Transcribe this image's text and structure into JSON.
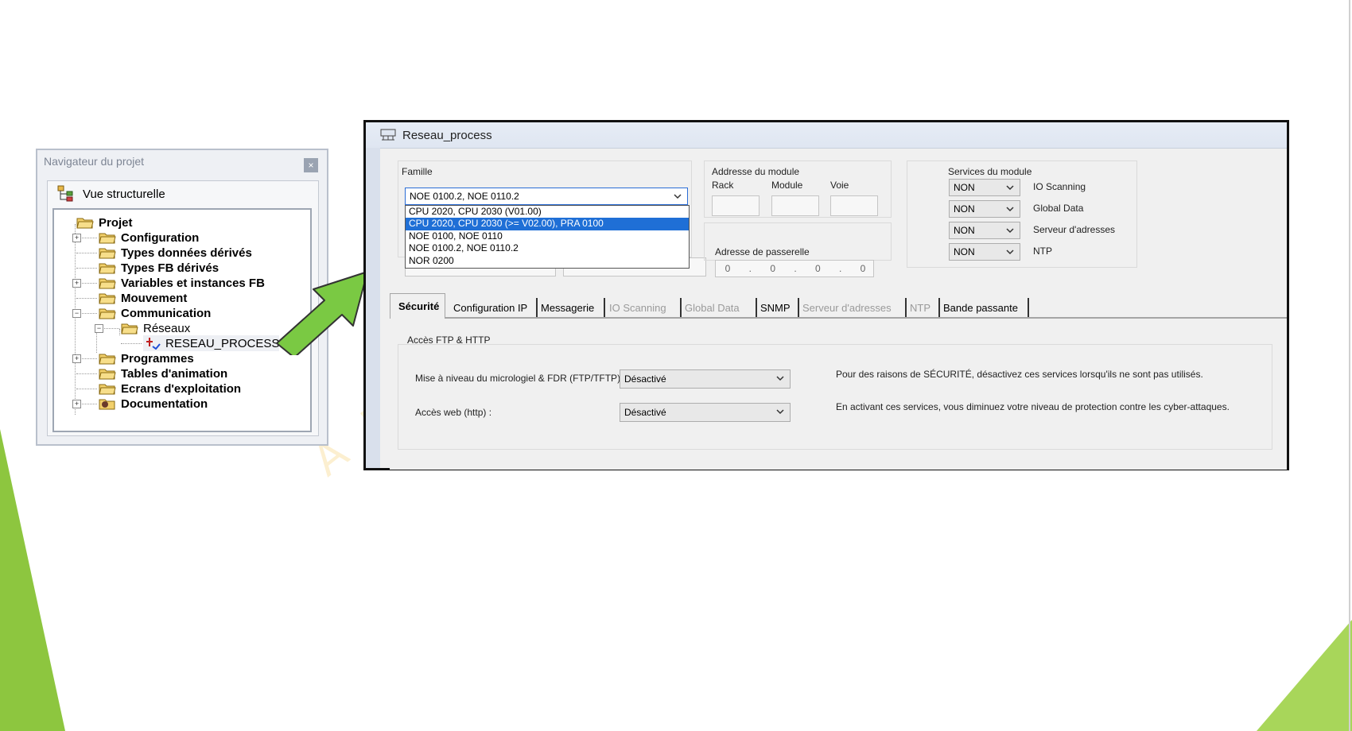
{
  "navigator": {
    "title": "Navigateur du projet",
    "close": "×",
    "view": "Vue structurelle",
    "tree": [
      {
        "label": "Projet",
        "expander": ""
      },
      {
        "label": "Configuration",
        "expander": "+"
      },
      {
        "label": "Types données dérivés",
        "expander": ""
      },
      {
        "label": "Types FB dérivés",
        "expander": ""
      },
      {
        "label": "Variables et instances FB",
        "expander": "+"
      },
      {
        "label": "Mouvement",
        "expander": ""
      },
      {
        "label": "Communication",
        "expander": "−"
      },
      {
        "label": "Réseaux",
        "expander": "−"
      },
      {
        "label": "RESEAU_PROCESS",
        "expander": ""
      },
      {
        "label": "Programmes",
        "expander": "+"
      },
      {
        "label": "Tables d'animation",
        "expander": ""
      },
      {
        "label": "Ecrans d'exploitation",
        "expander": ""
      },
      {
        "label": "Documentation",
        "expander": "+"
      }
    ]
  },
  "dialog": {
    "title": "Reseau_process",
    "famille": {
      "label": "Famille",
      "value": "NOE 0100.2, NOE 0110.2",
      "options": [
        "CPU 2020, CPU 2030 (V01.00)",
        "CPU 2020, CPU 2030 (>= V02.00), PRA 0100",
        "NOE 0100, NOE 0110",
        "NOE 0100.2, NOE 0110.2",
        "NOR 0200"
      ],
      "selected_index": 1
    },
    "address": {
      "label": "Addresse du module",
      "rack": "Rack",
      "module": "Module",
      "voie": "Voie"
    },
    "gateway": {
      "label": "Adresse de passerelle",
      "octets": [
        "0",
        "0",
        "0",
        "0"
      ],
      "dot": "."
    },
    "services": {
      "label": "Services du module",
      "items": [
        {
          "value": "NON",
          "name": "IO Scanning"
        },
        {
          "value": "NON",
          "name": "Global Data"
        },
        {
          "value": "NON",
          "name": "Serveur d'adresses"
        },
        {
          "value": "NON",
          "name": "NTP"
        }
      ]
    },
    "tabs": [
      {
        "label": "Sécurité",
        "state": "active"
      },
      {
        "label": "Configuration IP",
        "state": "normal"
      },
      {
        "label": "Messagerie",
        "state": "normal"
      },
      {
        "label": "IO Scanning",
        "state": "disabled"
      },
      {
        "label": "Global Data",
        "state": "disabled"
      },
      {
        "label": "SNMP",
        "state": "normal"
      },
      {
        "label": "Serveur d'adresses",
        "state": "disabled"
      },
      {
        "label": "NTP",
        "state": "disabled"
      },
      {
        "label": "Bande passante",
        "state": "normal"
      }
    ],
    "security": {
      "group_label": "Accès FTP & HTTP",
      "firmware_label": "Mise à niveau du micrologiel & FDR (FTP/TFTP):",
      "firmware_value": "Désactivé",
      "web_label": "Accès web (http) :",
      "web_value": "Désactivé",
      "note1": "Pour des raisons de SÉCURITÉ, désactivez ces services lorsqu'ils ne sont pas utilisés.",
      "note2": "En activant ces services, vous diminuez votre niveau de protection contre les cyber-attaques."
    }
  },
  "watermark": "AEI   FOR",
  "colors": {
    "arrow": "#7ac943",
    "accent": "#1f6fd6",
    "deco": "#8dc63f"
  }
}
